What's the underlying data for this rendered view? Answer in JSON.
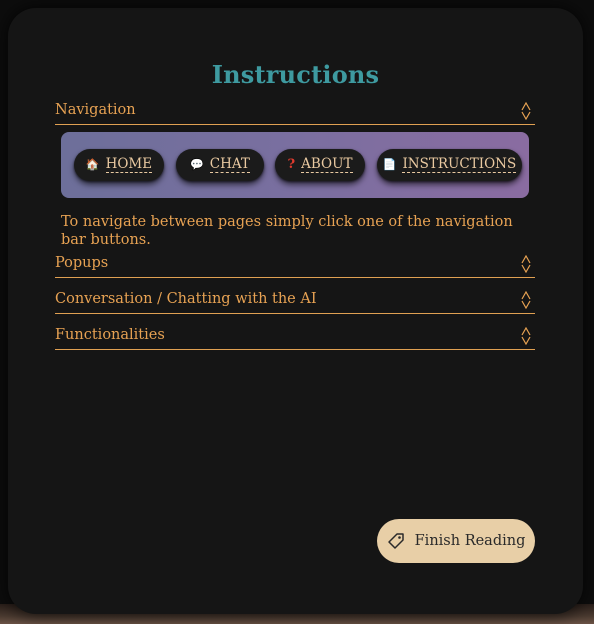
{
  "page": {
    "title": "Instructions"
  },
  "sections": [
    {
      "label": "Navigation",
      "expanded": true
    },
    {
      "label": "Popups",
      "expanded": false
    },
    {
      "label": "Conversation / Chatting with the AI",
      "expanded": false
    },
    {
      "label": "Functionalities",
      "expanded": false
    }
  ],
  "navigation_demo": {
    "buttons": [
      {
        "label": "HOME",
        "icon": "house-icon"
      },
      {
        "label": "CHAT",
        "icon": "speech-bubble-icon"
      },
      {
        "label": "ABOUT",
        "icon": "question-mark-icon"
      },
      {
        "label": "INSTRUCTIONS",
        "icon": "document-icon"
      }
    ],
    "description": "To navigate between pages simply click one of the navigation bar buttons."
  },
  "footer": {
    "finish_label": "Finish Reading",
    "finish_icon": "tag-icon"
  },
  "colors": {
    "title": "#3e9aa0",
    "accent": "#e7a253",
    "finish_button": "#e8cfa7",
    "panel": "#151515"
  }
}
